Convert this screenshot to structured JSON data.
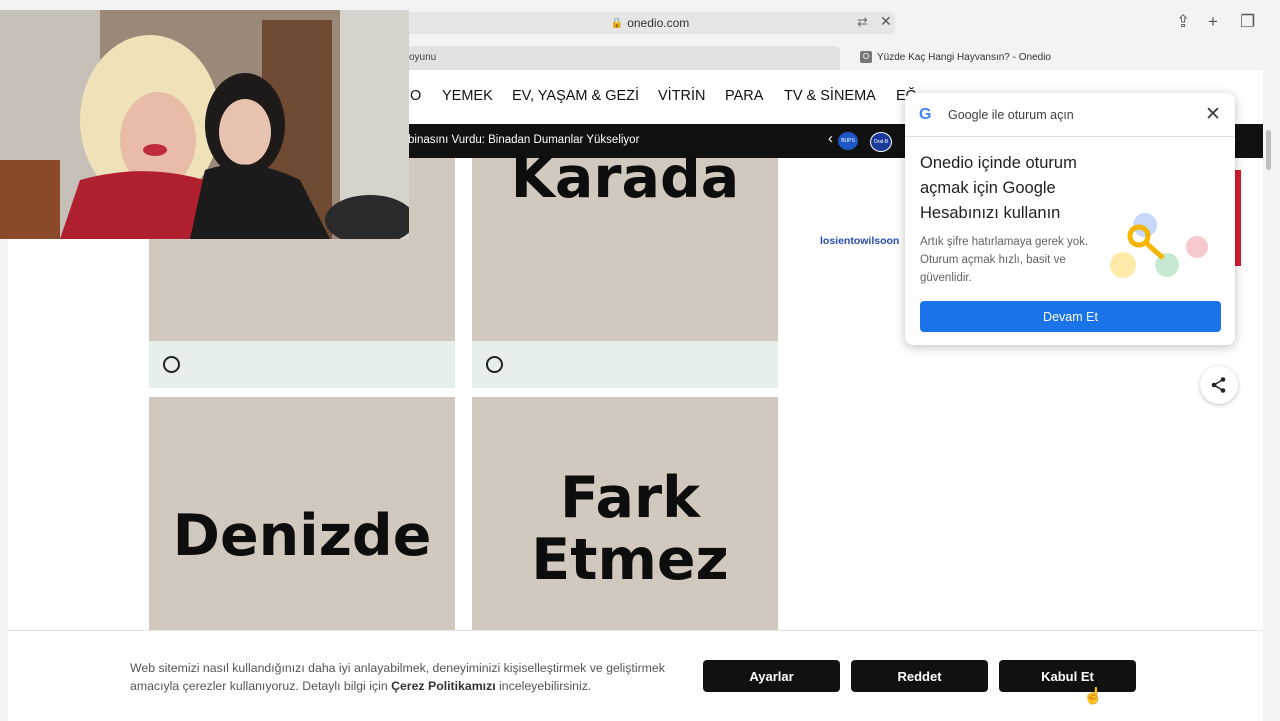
{
  "browser": {
    "url": "onedio.com",
    "tabs": [
      {
        "title": "oyunu"
      },
      {
        "title": "Yüzde Kaç Hangi Hayvansın? - Onedio",
        "favicon": "O"
      }
    ]
  },
  "nav": {
    "items": [
      "O",
      "YEMEK",
      "EV, YAŞAM & GEZİ",
      "VİTRİN",
      "PARA",
      "TV & SİNEMA",
      "EĞ..."
    ]
  },
  "ticker": {
    "text": "binasını Vurdu: Binadan Dumanlar Yükseliyor",
    "logo1": "BUPS",
    "logo2": "Oral-B"
  },
  "quiz": {
    "options": [
      "Karada",
      "Denizde",
      "Fark Etmez"
    ]
  },
  "sidebar": {
    "watermark": "losientowilsoon"
  },
  "google_popup": {
    "header": "Google ile oturum açın",
    "heading": "Onedio içinde oturum açmak için Google Hesabınızı kullanın",
    "body": "Artık şifre hatırlamaya gerek yok. Oturum açmak hızlı, basit ve güvenlidir.",
    "button": "Devam Et"
  },
  "cookie": {
    "text_pre": "Web sitemizi nasıl kullandığınızı daha iyi anlayabilmek, deneyiminizi kişiselleştirmek ve geliştirmek amacıyla çerezler kullanıyoruz. Detaylı bilgi için ",
    "link": "Çerez Politikamızı",
    "text_post": " inceleyebilirsiniz.",
    "buttons": {
      "settings": "Ayarlar",
      "reject": "Reddet",
      "accept": "Kabul Et"
    }
  },
  "colors": {
    "card_bg": "#d1c9bd",
    "card_footer": "#e6efee",
    "google_blue": "#1a73e8",
    "ticker_bg": "#111111"
  }
}
